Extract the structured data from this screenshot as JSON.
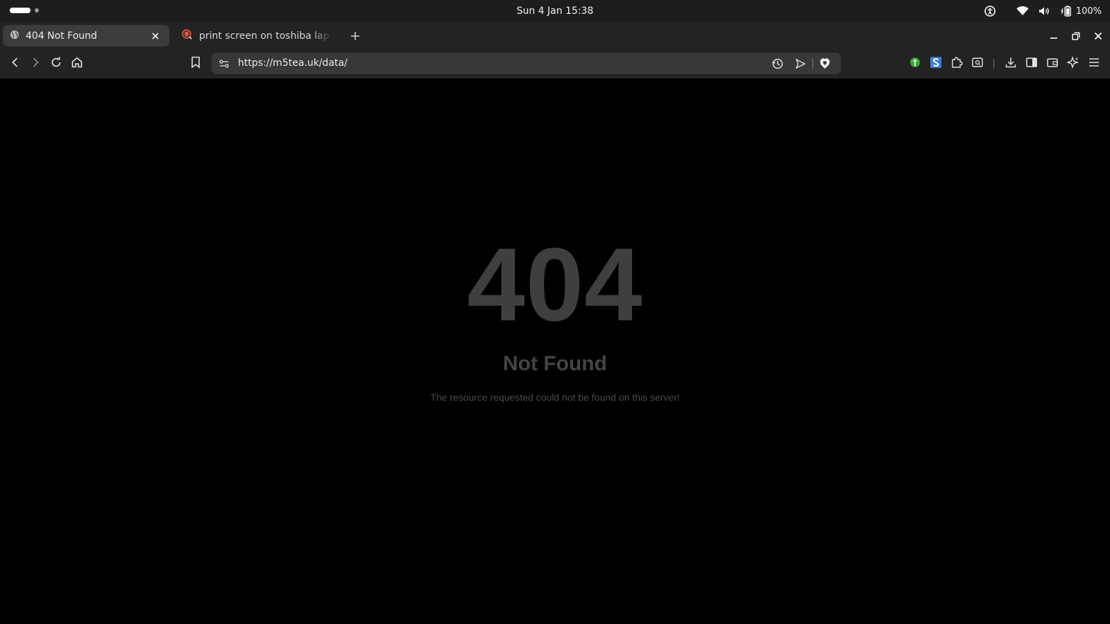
{
  "system_bar": {
    "clock": "Sun 4 Jan  15:38",
    "battery": "100%",
    "icons": [
      "accessibility-icon",
      "wifi-icon",
      "volume-icon",
      "battery-icon"
    ]
  },
  "tabs": [
    {
      "title": "404 Not Found",
      "icon": "globe-icon",
      "active": true
    },
    {
      "title": "print screen on toshiba lap - E",
      "icon": "brave-search-icon",
      "active": false
    }
  ],
  "toolbar": {
    "url": "https://m5tea.uk/data/"
  },
  "page": {
    "code": "404",
    "title": "Not Found",
    "message": "The resource requested could not be found on this server!"
  },
  "colors": {
    "background": "#000000",
    "chrome": "#232323",
    "active_tab": "#3c3c3c",
    "urlbar": "#383838",
    "error_text": "#3f3f3f"
  }
}
